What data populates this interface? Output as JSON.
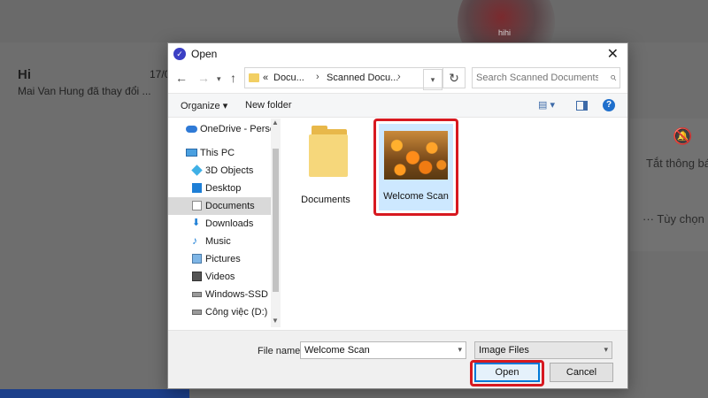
{
  "background": {
    "avatar_text": "hihi",
    "chat": {
      "title": "Hi",
      "time": "17/0",
      "subtitle": "Mai Van Hung đã thay đổi ..."
    },
    "mute_label": "Tắt thông bá",
    "options_label": "··· Tùy chọn"
  },
  "dialog": {
    "title": "Open",
    "address": {
      "prefix": "«",
      "crumbs": [
        "Docu...",
        "Scanned Docu..."
      ]
    },
    "search": {
      "placeholder": "Search Scanned Documents"
    },
    "toolbar": {
      "organize": "Organize ▾",
      "new_folder": "New folder"
    },
    "nav_items": [
      {
        "label": "OneDrive - Person",
        "icon": "onedrive-icon"
      },
      {
        "label": "This PC",
        "icon": "pc-icon"
      },
      {
        "label": "3D Objects",
        "icon": "3d-objects-icon"
      },
      {
        "label": "Desktop",
        "icon": "desktop-icon"
      },
      {
        "label": "Documents",
        "icon": "documents-icon",
        "selected": true
      },
      {
        "label": "Downloads",
        "icon": "downloads-icon"
      },
      {
        "label": "Music",
        "icon": "music-icon"
      },
      {
        "label": "Pictures",
        "icon": "pictures-icon"
      },
      {
        "label": "Videos",
        "icon": "videos-icon"
      },
      {
        "label": "Windows-SSD (C",
        "icon": "drive-icon"
      },
      {
        "label": "Công việc (D:)",
        "icon": "drive-icon"
      }
    ],
    "files": [
      {
        "label": "Documents",
        "type": "folder"
      },
      {
        "label": "Welcome Scan",
        "type": "image",
        "selected": true
      }
    ],
    "file_name": {
      "label": "File name:",
      "value": "Welcome Scan"
    },
    "file_type": {
      "value": "Image Files"
    },
    "buttons": {
      "open": "Open",
      "cancel": "Cancel"
    }
  }
}
